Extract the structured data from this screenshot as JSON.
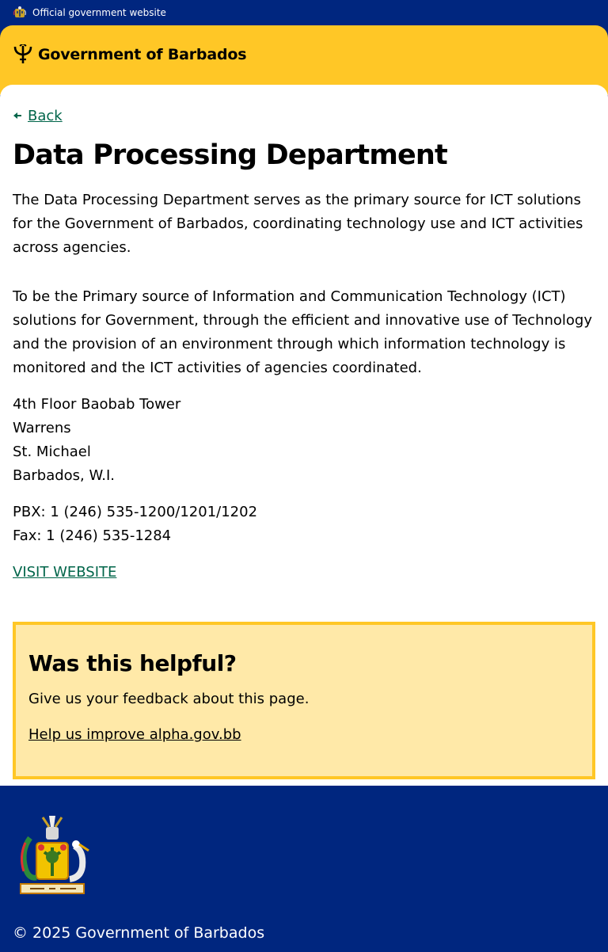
{
  "topbar": {
    "official_text": "Official government website",
    "crest_icon": "barbados-crest-icon"
  },
  "header": {
    "brand_name": "Government of Barbados",
    "trident_icon": "trident-icon"
  },
  "main": {
    "back_label": "Back",
    "title": "Data Processing Department",
    "intro": "The Data Processing Department serves as the primary source for ICT solutions for the Government of Barbados, coordinating technology use and ICT activities across agencies.",
    "mission": "To be the Primary source of Information and Communication Technology (ICT) solutions for Government, through the efficient and innovative use of Technology and the provision of an environment through which information technology is monitored and the ICT activities of agencies coordinated.",
    "address": [
      "4th Floor Baobab Tower",
      "Warrens",
      "St. Michael",
      "Barbados, W.I."
    ],
    "phones": [
      "PBX: 1 (246) 535-1200/1201/1202",
      "Fax: 1 (246) 535-1284"
    ],
    "visit_label": "VISIT WEBSITE"
  },
  "feedback": {
    "heading": "Was this helpful?",
    "text": "Give us your feedback about this page.",
    "link": "Help us improve alpha.gov.bb"
  },
  "footer": {
    "copyright": "© 2025 Government of Barbados",
    "coat_of_arms_icon": "coat-of-arms-icon"
  },
  "colors": {
    "navy": "#00267f",
    "gold": "#ffc726",
    "feedback_bg": "#ffe9a8",
    "link_green": "#00654a"
  }
}
